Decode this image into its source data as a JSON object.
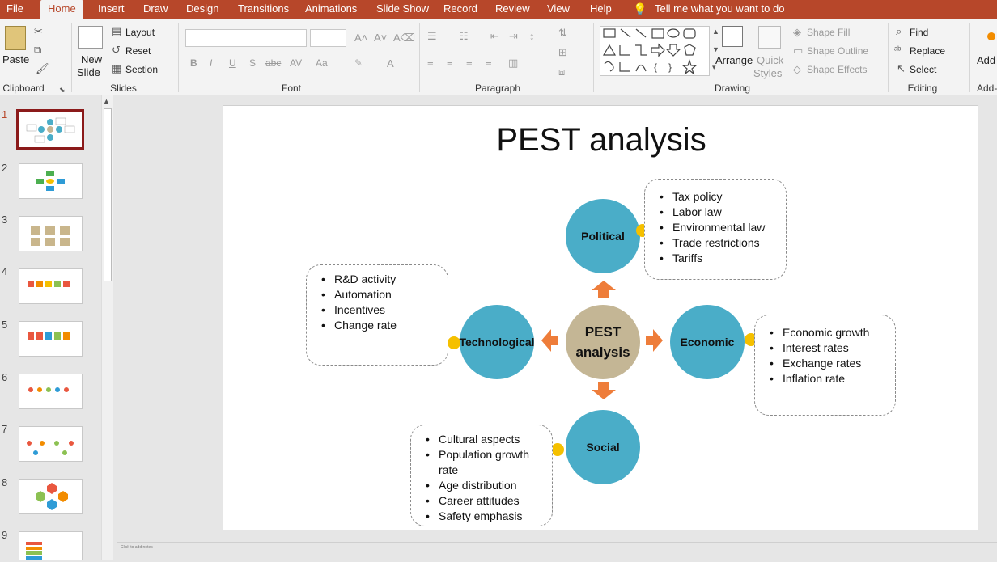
{
  "tabs": [
    "File",
    "Home",
    "Insert",
    "Draw",
    "Design",
    "Transitions",
    "Animations",
    "Slide Show",
    "Record",
    "Review",
    "View",
    "Help"
  ],
  "tell_me": "Tell me what you want to do",
  "ribbon": {
    "clipboard": {
      "paste": "Paste",
      "label": "Clipboard"
    },
    "slides": {
      "new_slide_line1": "New",
      "new_slide_line2": "Slide",
      "layout": "Layout",
      "reset": "Reset",
      "section": "Section",
      "label": "Slides"
    },
    "font": {
      "label": "Font",
      "bold": "B",
      "italic": "I",
      "underline": "U",
      "shadow": "S",
      "strike": "abc",
      "spacing": "AV",
      "case": "Aa",
      "color": "A"
    },
    "paragraph": {
      "label": "Paragraph"
    },
    "drawing": {
      "arrange": "Arrange",
      "quick_styles_line1": "Quick",
      "quick_styles_line2": "Styles",
      "shape_fill": "Shape Fill",
      "shape_outline": "Shape Outline",
      "shape_effects": "Shape Effects",
      "label": "Drawing"
    },
    "editing": {
      "find": "Find",
      "replace": "Replace",
      "select": "Select",
      "label": "Editing"
    },
    "addins": {
      "addins": "Add-",
      "label": "Add-"
    }
  },
  "thumbnails": [
    "1",
    "2",
    "3",
    "4",
    "5",
    "6",
    "7",
    "8",
    "9"
  ],
  "status_note": "Click to add notes",
  "slide": {
    "title": "PEST analysis",
    "center_line1": "PEST",
    "center_line2": "analysis",
    "political": {
      "label": "Political",
      "items": [
        "Tax policy",
        "Labor law",
        "Environmental law",
        "Trade restrictions",
        "Tariffs"
      ]
    },
    "economic": {
      "label": "Economic",
      "items": [
        "Economic growth",
        "Interest rates",
        "Exchange rates",
        "Inflation rate"
      ]
    },
    "social": {
      "label": "Social",
      "items": [
        "Cultural aspects",
        "Population growth rate",
        "Age distribution",
        "Career attitudes",
        "Safety emphasis"
      ]
    },
    "technological": {
      "label": "Technological",
      "items": [
        "R&D activity",
        "Automation",
        "Incentives",
        "Change rate"
      ]
    }
  },
  "colors": {
    "accent": "#b7472a",
    "circle": "#4aadc8",
    "center": "#c4b695",
    "arrow": "#ee7d3a",
    "dot": "#f5c000"
  }
}
